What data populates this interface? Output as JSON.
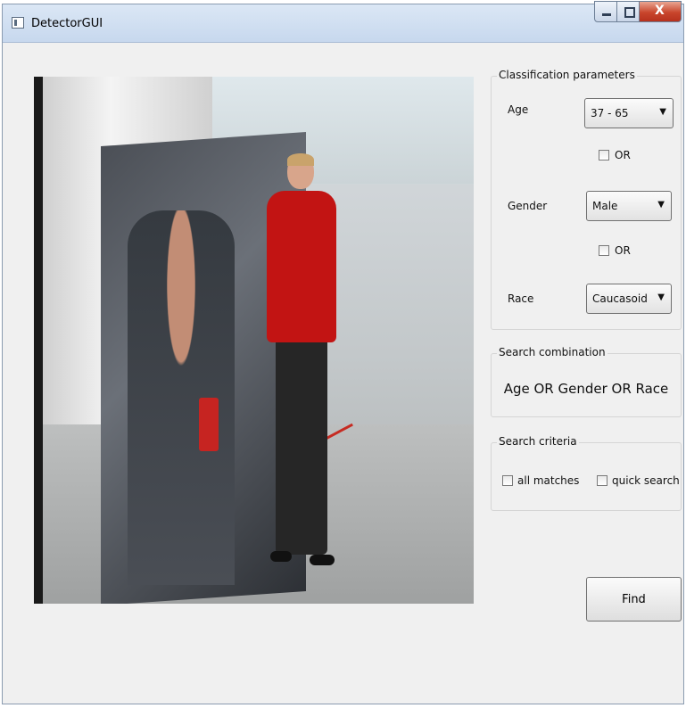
{
  "window": {
    "title": "DetectorGUI",
    "close_glyph": "X"
  },
  "classification": {
    "group_title": "Classification parameters",
    "age_label": "Age",
    "age_value": "37 - 65",
    "gender_label": "Gender",
    "gender_value": "Male",
    "race_label": "Race",
    "race_value": "Caucasoid",
    "or_label_1": "OR",
    "or_label_2": "OR",
    "or_checked_1": false,
    "or_checked_2": false,
    "dropdown_arrow": "▼"
  },
  "search_combination": {
    "group_title": "Search combination",
    "text": "Age OR Gender OR Race"
  },
  "search_criteria": {
    "group_title": "Search criteria",
    "all_matches_label": "all matches",
    "quick_search_label": "quick search",
    "all_matches_checked": false,
    "quick_search_checked": false
  },
  "find_label": "Find",
  "colors": {
    "shirt": "#c21413",
    "close_button": "#c9452c",
    "window_frame": "#dbe7f5"
  }
}
